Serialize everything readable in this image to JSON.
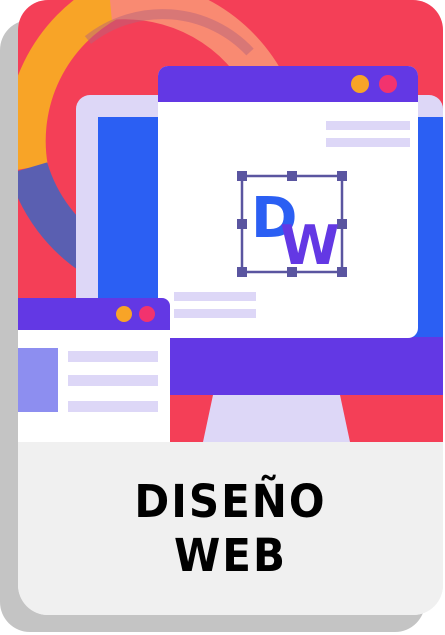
{
  "card": {
    "title_line1": "DISEÑO",
    "title_line2": "WEB"
  },
  "logo": {
    "letter_d": "D",
    "letter_w": "W"
  },
  "colors": {
    "background_red": "#f43f57",
    "purple": "#6338e4",
    "blue": "#2b5ff3",
    "lavender": "#ddd7f7",
    "orange": "#f8a427",
    "pink": "#f2336e",
    "gray": "#f0f0f0"
  }
}
